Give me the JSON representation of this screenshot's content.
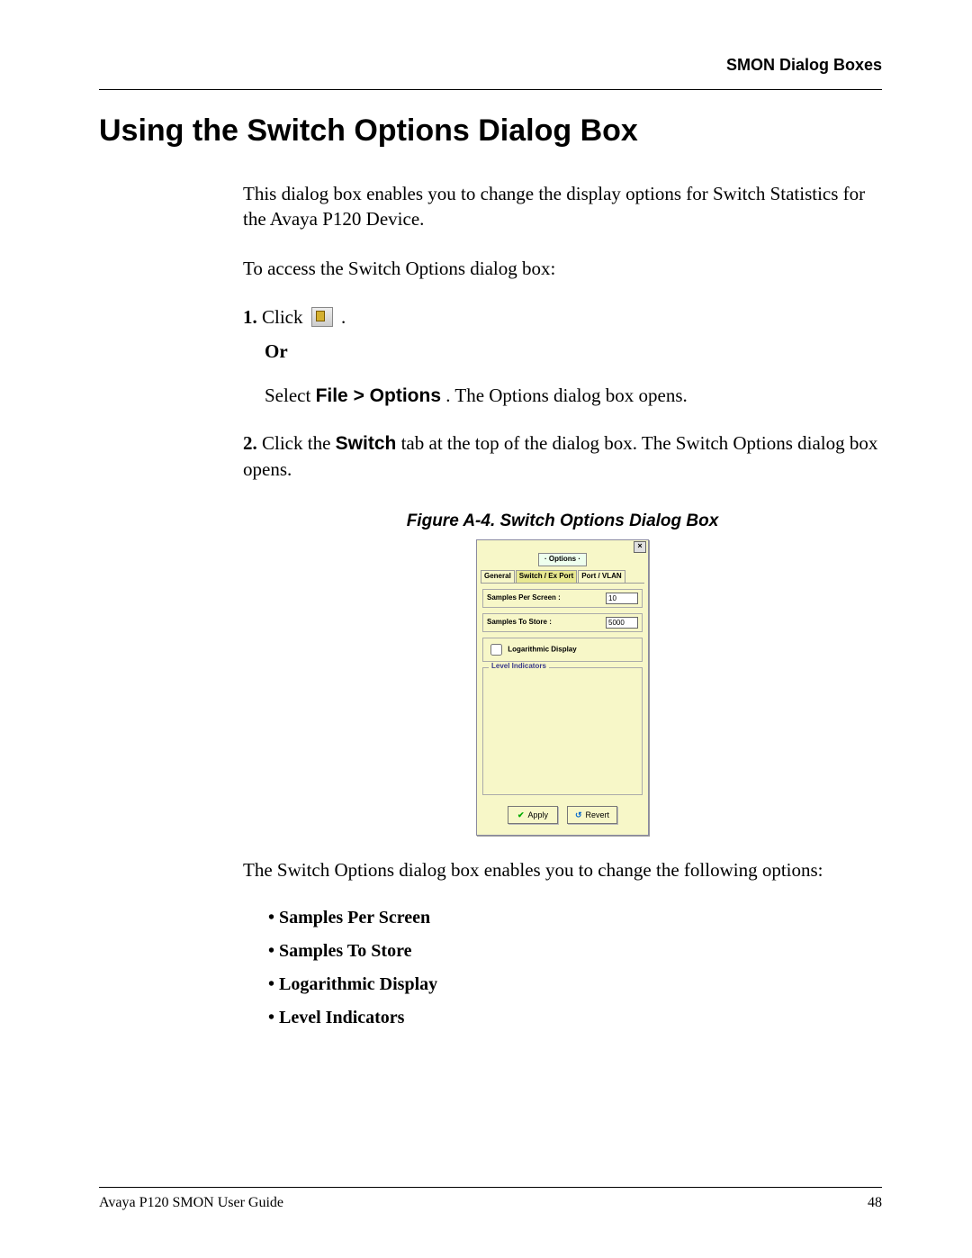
{
  "header": {
    "section": "SMON Dialog Boxes"
  },
  "title": "Using the Switch Options Dialog Box",
  "intro": "This dialog box enables you to change the display options for Switch Statistics for the Avaya P120 Device.",
  "access_line": "To access the Switch Options dialog box:",
  "steps": {
    "s1_num": "1.",
    "s1_a": "Click ",
    "s1_b": " .",
    "or": "Or",
    "s1_alt_a": "Select ",
    "s1_alt_menu": "File > Options",
    "s1_alt_b": ". The Options dialog box opens.",
    "s2_num": "2.",
    "s2_a": "Click the ",
    "s2_b": "Switch",
    "s2_c": " tab at the top of the dialog box. The Switch Options dialog box opens."
  },
  "figure": {
    "caption": "Figure A-4.  Switch Options Dialog Box"
  },
  "dialog": {
    "badge": "· Options ·",
    "tabs": {
      "t1": "General",
      "t2": "Switch / Ex Port",
      "t3": "Port / VLAN"
    },
    "f1_label": "Samples Per Screen :",
    "f1_value": "10",
    "f2_label": "Samples To Store :",
    "f2_value": "5000",
    "chk_label": "Logarithmic Display",
    "group_label": "Level Indicators",
    "apply": "Apply",
    "revert": "Revert"
  },
  "after_fig": "The Switch Options dialog box enables you to change the following options:",
  "bullets": {
    "b1": "Samples Per Screen",
    "b2": "Samples To Store",
    "b3": "Logarithmic Display",
    "b4": "Level Indicators"
  },
  "footer": {
    "left": "Avaya P120 SMON User Guide",
    "right": "48"
  }
}
